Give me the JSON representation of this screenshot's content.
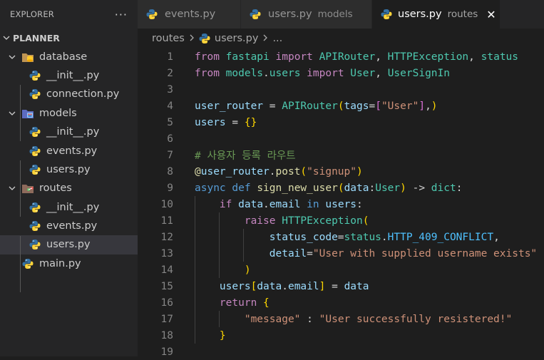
{
  "explorer": {
    "title": "EXPLORER",
    "more_label": "···",
    "root": "PLANNER",
    "items": [
      {
        "label": "database",
        "kind": "folder",
        "icon": "database-folder-icon"
      },
      {
        "label": "__init__.py",
        "kind": "file",
        "icon": "python-icon"
      },
      {
        "label": "connection.py",
        "kind": "file",
        "icon": "python-icon"
      },
      {
        "label": "models",
        "kind": "folder",
        "icon": "models-folder-icon"
      },
      {
        "label": "__init__.py",
        "kind": "file",
        "icon": "python-icon"
      },
      {
        "label": "events.py",
        "kind": "file",
        "icon": "python-icon"
      },
      {
        "label": "users.py",
        "kind": "file",
        "icon": "python-icon"
      },
      {
        "label": "routes",
        "kind": "folder",
        "icon": "routes-folder-icon"
      },
      {
        "label": "__init__.py",
        "kind": "file",
        "icon": "python-icon"
      },
      {
        "label": "events.py",
        "kind": "file",
        "icon": "python-icon"
      },
      {
        "label": "users.py",
        "kind": "file",
        "icon": "python-icon",
        "selected": true
      },
      {
        "label": "main.py",
        "kind": "file",
        "icon": "python-icon"
      }
    ]
  },
  "tabs": [
    {
      "label": "events.py",
      "desc": ""
    },
    {
      "label": "users.py",
      "desc": "models"
    },
    {
      "label": "users.py",
      "desc": "routes",
      "active": true,
      "close": "✕"
    }
  ],
  "breadcrumb": {
    "folder": "routes",
    "file": "users.py",
    "tail": "..."
  },
  "editor": {
    "line_numbers": [
      "1",
      "2",
      "3",
      "4",
      "5",
      "6",
      "7",
      "8",
      "9",
      "10",
      "11",
      "12",
      "13",
      "14",
      "15",
      "16",
      "17",
      "18",
      "19"
    ]
  },
  "colors": {
    "python_blue": "#3572a5",
    "python_yellow": "#ffd43b",
    "selection": "#37373d"
  }
}
